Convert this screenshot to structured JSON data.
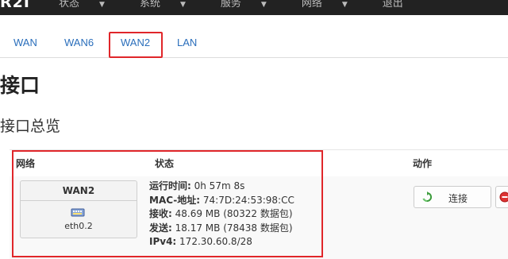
{
  "header": {
    "brand": "R2I",
    "menu": [
      {
        "label": "状态"
      },
      {
        "label": "系统"
      },
      {
        "label": "服务"
      },
      {
        "label": "网络"
      },
      {
        "label": "退出"
      }
    ]
  },
  "tabs": [
    {
      "label": "WAN"
    },
    {
      "label": "WAN6"
    },
    {
      "label": "WAN2",
      "active": true
    },
    {
      "label": "LAN"
    }
  ],
  "page": {
    "title": "接口",
    "section": "接口总览"
  },
  "table": {
    "headers": {
      "network": "网络",
      "status": "状态",
      "actions": "动作"
    },
    "row": {
      "iface_name": "WAN2",
      "device": "eth0.2",
      "status": [
        {
          "key": "运行时间:",
          "value": " 0h 57m 8s"
        },
        {
          "key": "MAC-地址:",
          "value": " 74:7D:24:53:98:CC"
        },
        {
          "key": "接收:",
          "value": " 48.69 MB (80322 数据包)"
        },
        {
          "key": "发送:",
          "value": " 18.17 MB (78438 数据包)"
        },
        {
          "key": "IPv4:",
          "value": " 172.30.60.8/28"
        }
      ],
      "connect_label": "连接"
    }
  },
  "colors": {
    "highlight": "#e0262a",
    "link": "#2a6ebb",
    "navbar": "#222222"
  }
}
